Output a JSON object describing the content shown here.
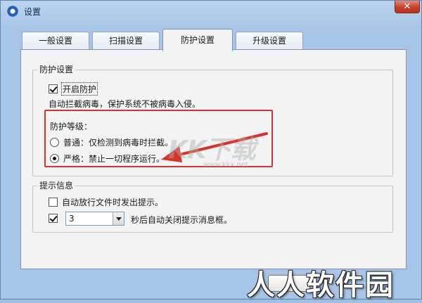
{
  "window": {
    "title": "设置",
    "close_label": "✕"
  },
  "tabs": [
    {
      "label": "一般设置",
      "active": false
    },
    {
      "label": "扫描设置",
      "active": false
    },
    {
      "label": "防护设置",
      "active": true
    },
    {
      "label": "升级设置",
      "active": false
    }
  ],
  "protection": {
    "group_title": "防护设置",
    "enable_label": "开启防护",
    "enable_checked": true,
    "description": "自动拦截病毒，保护系统不被病毒入侵。",
    "level_title": "防护等级：",
    "levels": [
      {
        "label": "普通：仅检测到病毒时拦截。",
        "selected": false
      },
      {
        "label": "严格：禁止一切程序运行。",
        "selected": true
      }
    ]
  },
  "notice": {
    "group_title": "提示信息",
    "auto_release_label": "自动放行文件时发出提示。",
    "auto_release_checked": false,
    "auto_close_checked": true,
    "auto_close_seconds": "3",
    "auto_close_suffix": "秒后自动关闭提示消息框。"
  },
  "annotation": {
    "color": "#d6342a"
  },
  "watermarks": {
    "site_logo": "KK下载",
    "site_url": "www.kkx.net",
    "brand": "人人软件园"
  },
  "colors": {
    "frame": "#a7c5e6",
    "panel": "#f3f3f3",
    "close": "#c4412a"
  }
}
